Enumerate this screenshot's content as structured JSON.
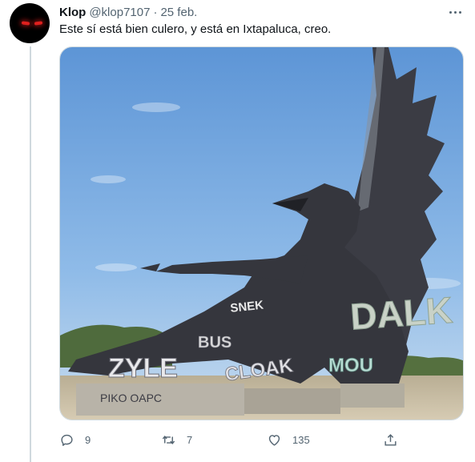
{
  "tweet": {
    "author_name": "Klop",
    "author_handle": "@klop7107",
    "separator": "·",
    "date": "25 feb.",
    "text": "Este sí está bien culero, y está en Ixtapaluca, creo.",
    "media_description_colors": {
      "sky": "#7fb0e3",
      "statue": "#3a3b42",
      "ground": "#c9bfa8"
    }
  },
  "actions": {
    "reply_count": "9",
    "retweet_count": "7",
    "like_count": "135"
  },
  "graffiti": {
    "big_tag": "DALK",
    "tag_2": "SNEK",
    "tag_3": "BUS",
    "tag_4": "ZYLE",
    "tag_5": "CLOAK",
    "tag_6": "PIKO OAPC",
    "tag_7": "MOU"
  },
  "icons": {
    "reply": "reply-icon",
    "retweet": "retweet-icon",
    "like": "heart-icon",
    "share": "share-icon",
    "more": "more-icon"
  }
}
